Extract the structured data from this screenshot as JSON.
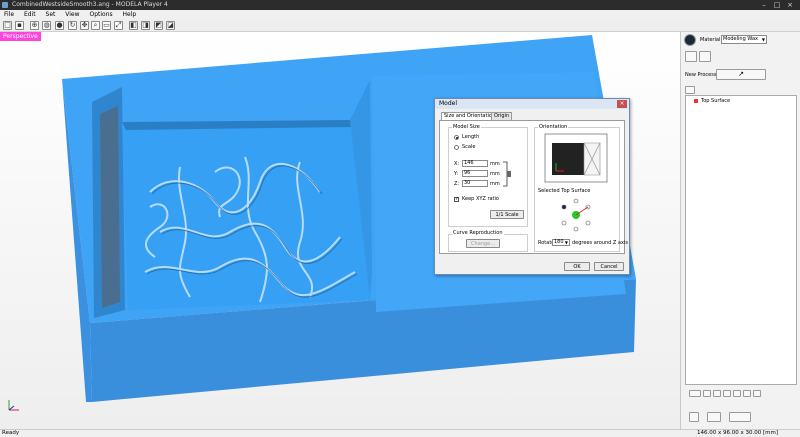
{
  "window": {
    "title": "CombinedWestsideSmooth3.ang - MODELA Player 4",
    "controls": [
      "–",
      "□",
      "×"
    ]
  },
  "menu": [
    "File",
    "Edit",
    "Set",
    "View",
    "Options",
    "Help"
  ],
  "viewport": {
    "view_label": "Perspective"
  },
  "right_panel": {
    "material_label": "Material",
    "material_value": "Modeling Wax",
    "new_process_label": "New Process",
    "tree_root": "Top Surface"
  },
  "status": {
    "left": "Ready",
    "right": "146.00 x 96.00 x 30.00 [mm]"
  },
  "dialog": {
    "title": "Model",
    "tabs": [
      "Size and Orientation",
      "Origin"
    ],
    "model_size": {
      "group_label": "Model Size",
      "opt_length": "Length",
      "opt_scale": "Scale",
      "x_label": "X:",
      "x_value": "146",
      "x_unit": "mm",
      "y_label": "Y:",
      "y_value": "96",
      "y_unit": "mm",
      "z_label": "Z:",
      "z_value": "30",
      "z_unit": "mm",
      "keep_ratio": "Keep XYZ ratio",
      "scale_button": "1/1 Scale"
    },
    "curve": {
      "group_label": "Curve Reproduction",
      "change_button": "Change..."
    },
    "orientation": {
      "group_label": "Orientation",
      "selected_top": "Selected Top Surface",
      "rotate_label": "Rotate",
      "rotate_value": "180",
      "rotate_suffix": "degrees around Z axis"
    },
    "ok": "OK",
    "cancel": "Cancel"
  }
}
